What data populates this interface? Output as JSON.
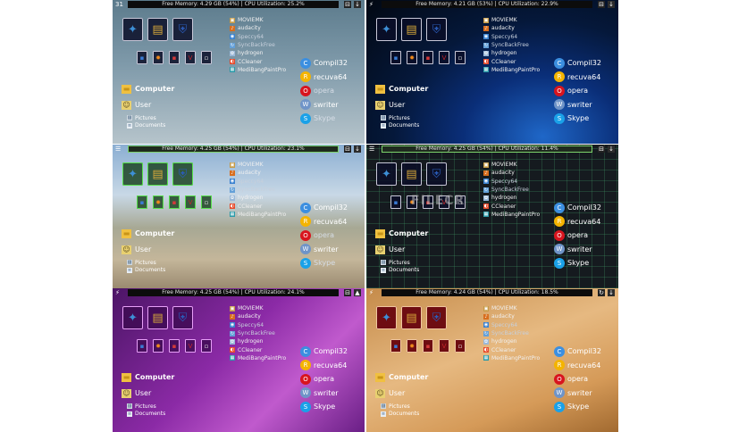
{
  "panels": [
    {
      "corner_icon": "31",
      "status_text": "Free Memory: 4.29 GB (54%) | CPU Utilization: 25.2%",
      "btn_a": "⊟",
      "btn_b": "↓",
      "frame": "dark"
    },
    {
      "corner_icon": "⚡",
      "status_text": "Free Memory: 4.21 GB (53%) | CPU Utilization: 22.9%",
      "btn_a": "⊟",
      "btn_b": "↓",
      "frame": "dark"
    },
    {
      "corner_icon": "☰",
      "status_text": "Free Memory: 4.25 GB (54%) | CPU Utilization: 23.1%",
      "btn_a": "⊟",
      "btn_b": "↓",
      "frame": "green"
    },
    {
      "corner_icon": "☰",
      "status_text": "Free Memory: 4.25 GB (54%) | CPU Utilization: 11.4%",
      "btn_a": "⊟",
      "btn_b": "↓",
      "frame": "dark",
      "watermark": "FILECR"
    },
    {
      "corner_icon": "⚡",
      "status_text": "Free Memory: 4.25 GB (54%) | CPU Utilization: 24.1%",
      "btn_a": "⊟",
      "btn_b": "▲",
      "frame": "purple"
    },
    {
      "corner_icon": "⚡",
      "status_text": "Free Memory: 4.24 GB (54%) | CPU Utilization: 18.5%",
      "btn_a": "↻",
      "btn_b": "↓",
      "frame": "red"
    }
  ],
  "apps": [
    "MOVIEMK",
    "audacity",
    "Speccy64",
    "SyncBackFree",
    "hydrogen",
    "CCleaner",
    "MediBangPaintPro"
  ],
  "places": {
    "computer": "Computer",
    "user": "User",
    "pictures": "Pictures",
    "documents": "Documents"
  },
  "right_items": [
    "Compil32",
    "recuva64",
    "opera",
    "swriter",
    "Skype"
  ],
  "colors": {
    "status_bar": "#0c0c0c",
    "status_outline_green": "#7dd36b",
    "opera": "#d8141e",
    "skype": "#1aa1e8",
    "recuva": "#f4b400",
    "compil": "#3c8fe0",
    "swriter": "#6f94c8"
  },
  "icons": {
    "big": [
      "kodi-icon",
      "database-icon",
      "shield-icon"
    ],
    "small": [
      "blue-app-icon",
      "flame-icon",
      "red-app-icon",
      "vivaldi-icon",
      "note-icon"
    ]
  }
}
